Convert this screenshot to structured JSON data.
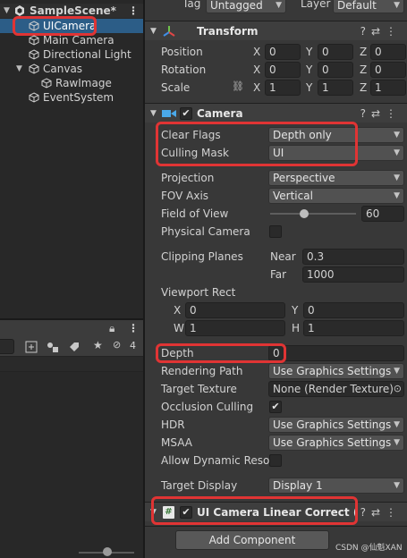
{
  "hierarchy": {
    "scene_name": "SampleScene*",
    "items": [
      {
        "label": "UICamera"
      },
      {
        "label": "Main Camera"
      },
      {
        "label": "Directional Light"
      },
      {
        "label": "Canvas"
      },
      {
        "label": "RawImage"
      },
      {
        "label": "EventSystem"
      }
    ],
    "count_badge": "4"
  },
  "top": {
    "tag_label": "Tag",
    "tag_value": "Untagged",
    "layer_label": "Layer",
    "layer_value": "Default"
  },
  "transform": {
    "title": "Transform",
    "position": {
      "label": "Position",
      "x": "0",
      "y": "0",
      "z": "0"
    },
    "rotation": {
      "label": "Rotation",
      "x": "0",
      "y": "0",
      "z": "0"
    },
    "scale": {
      "label": "Scale",
      "x": "1",
      "y": "1",
      "z": "1"
    }
  },
  "camera": {
    "title": "Camera",
    "clear_flags": {
      "label": "Clear Flags",
      "value": "Depth only"
    },
    "culling_mask": {
      "label": "Culling Mask",
      "value": "UI"
    },
    "projection": {
      "label": "Projection",
      "value": "Perspective"
    },
    "fov_axis": {
      "label": "FOV Axis",
      "value": "Vertical"
    },
    "fov": {
      "label": "Field of View",
      "value": "60",
      "slider_fraction": 0.4
    },
    "physical": {
      "label": "Physical Camera"
    },
    "clipping": {
      "label": "Clipping Planes",
      "near_label": "Near",
      "near": "0.3",
      "far_label": "Far",
      "far": "1000"
    },
    "viewport": {
      "label": "Viewport Rect",
      "x_label": "X",
      "x": "0",
      "y_label": "Y",
      "y": "0",
      "w_label": "W",
      "w": "1",
      "h_label": "H",
      "h": "1"
    },
    "depth": {
      "label": "Depth",
      "value": "0"
    },
    "rendering_path": {
      "label": "Rendering Path",
      "value": "Use Graphics Settings"
    },
    "target_texture": {
      "label": "Target Texture",
      "value": "None (Render Texture)"
    },
    "occlusion": {
      "label": "Occlusion Culling"
    },
    "hdr": {
      "label": "HDR",
      "value": "Use Graphics Settings"
    },
    "msaa": {
      "label": "MSAA",
      "value": "Use Graphics Settings"
    },
    "dynamic_res": {
      "label": "Allow Dynamic Resol"
    },
    "target_display": {
      "label": "Target Display",
      "value": "Display 1"
    }
  },
  "script_component": {
    "title": "UI Camera Linear Correct (Sci"
  },
  "add_component": "Add Component",
  "watermark": "CSDN @仙魁XAN",
  "axes": {
    "x": "X",
    "y": "Y",
    "z": "Z"
  }
}
